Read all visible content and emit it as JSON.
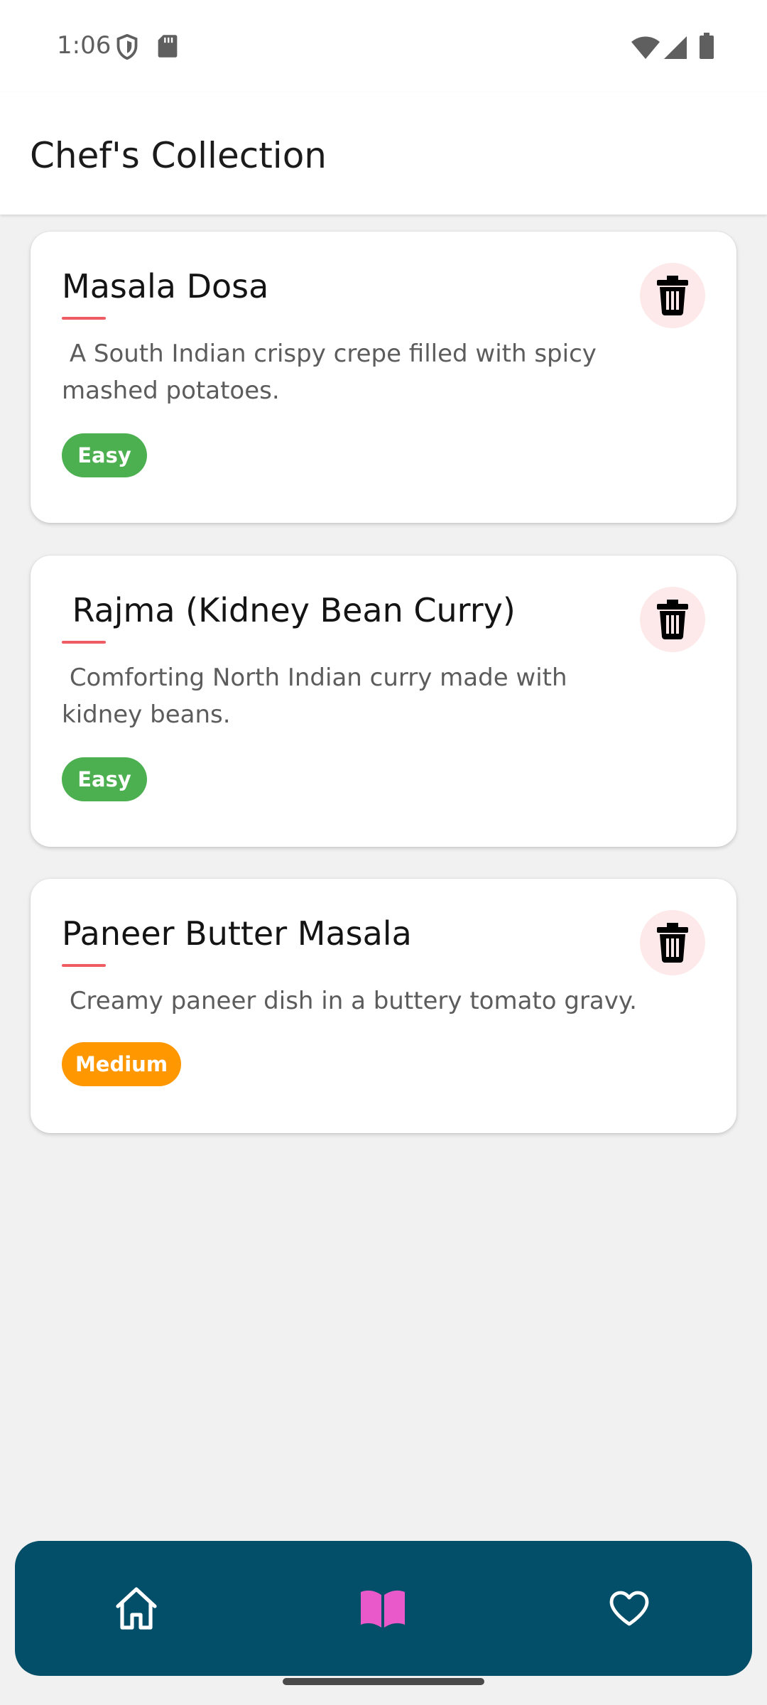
{
  "status_bar": {
    "time": "1:06",
    "icons": [
      "shield-icon",
      "sd-card-icon",
      "wifi-icon",
      "signal-icon",
      "battery-icon"
    ]
  },
  "app_bar": {
    "title": "Chef's Collection"
  },
  "recipes": [
    {
      "title": "Masala Dosa",
      "description": " A South Indian crispy crepe filled with spicy mashed potatoes.",
      "difficulty": "Easy",
      "difficulty_color": "#4caf50"
    },
    {
      "title": " Rajma (Kidney Bean Curry)",
      "description": " Comforting North Indian curry made with kidney beans.",
      "difficulty": "Easy",
      "difficulty_color": "#4caf50"
    },
    {
      "title": "Paneer Butter Masala",
      "description": " Creamy paneer dish in a buttery tomato gravy.",
      "difficulty": "Medium",
      "difficulty_color": "#ff9800"
    }
  ],
  "bottom_nav": {
    "items": [
      {
        "icon": "home-icon",
        "active": false
      },
      {
        "icon": "book-open-icon",
        "active": true
      },
      {
        "icon": "heart-icon",
        "active": false
      }
    ],
    "active_color": "#ea59c9",
    "inactive_color": "#ffffff",
    "background": "#034e68"
  },
  "colors": {
    "title_underline": "#ef5d63",
    "delete_button_bg": "#fde9e9"
  }
}
